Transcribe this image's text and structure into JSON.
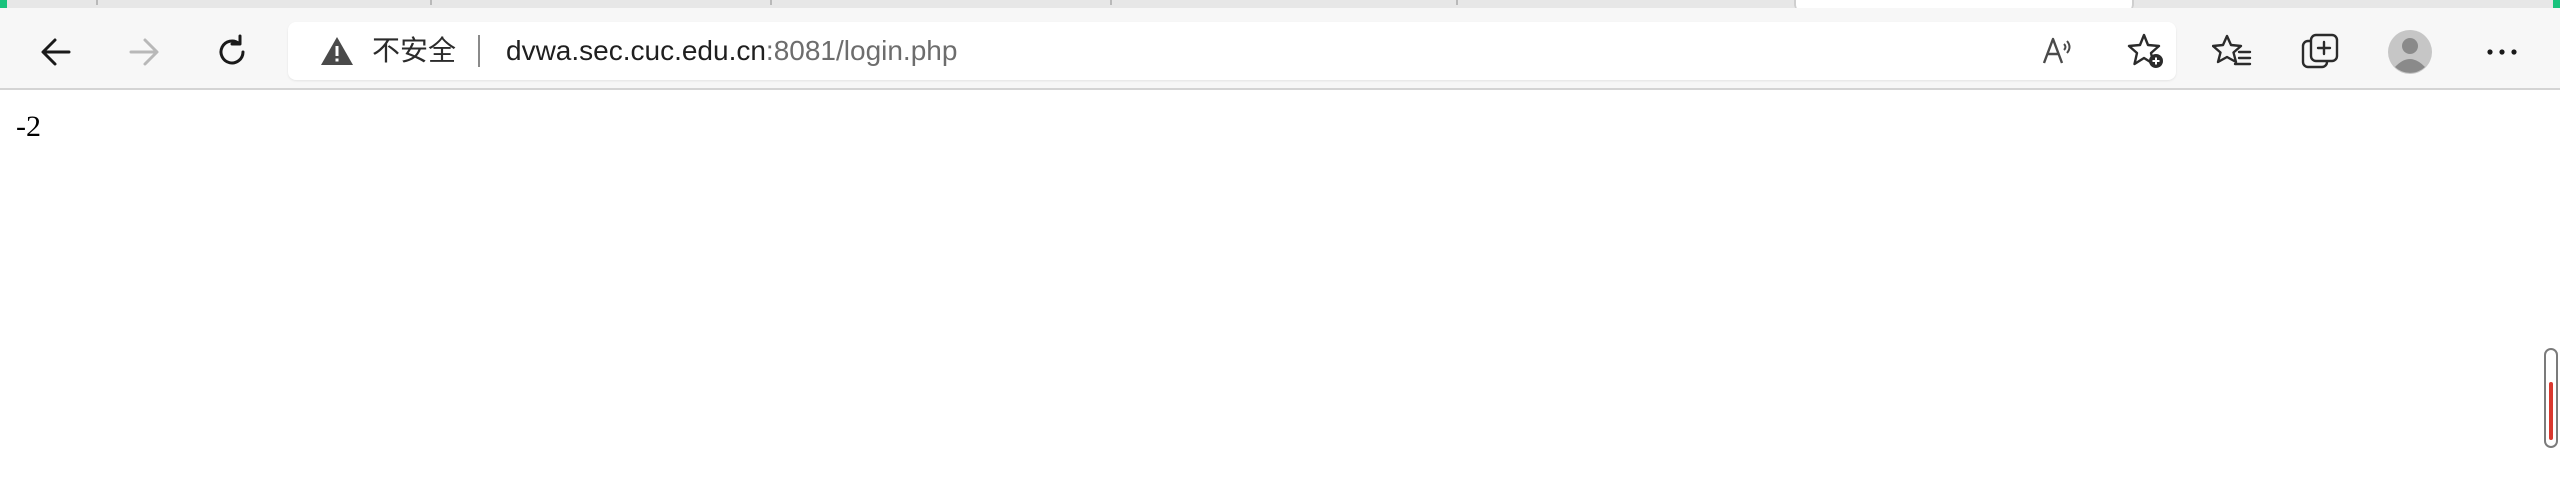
{
  "browser": {
    "address_bar": {
      "security_label": "不安全",
      "url_host": "dvwa.sec.cuc.edu.cn",
      "url_rest": ":8081/login.php"
    },
    "icons": {
      "back": "back-arrow-icon",
      "forward": "forward-arrow-icon",
      "refresh": "refresh-icon",
      "warning": "warning-triangle-icon",
      "read_aloud": "read-aloud-icon",
      "add_favorite": "add-favorite-icon",
      "favorites": "favorites-icon",
      "collections": "collections-icon",
      "profile": "profile-avatar-icon",
      "more": "more-options-icon"
    },
    "colors": {
      "accent": "#19c37d",
      "scroll_indicator": "#d9382f"
    }
  },
  "page": {
    "body_text": "-2"
  }
}
